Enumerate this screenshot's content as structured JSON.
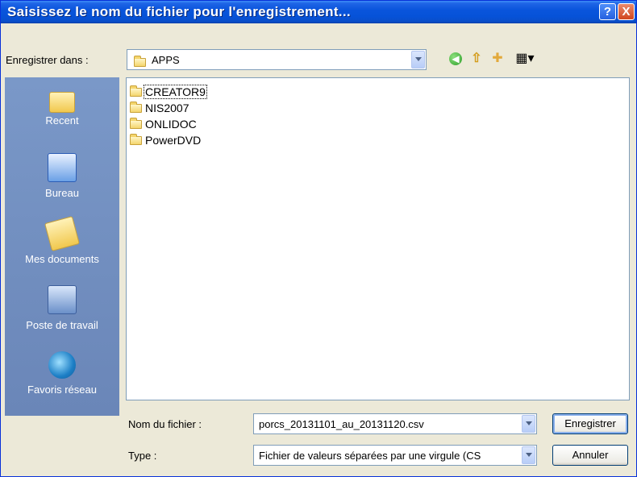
{
  "window": {
    "title": "Saisissez le nom du fichier pour l'enregistrement...",
    "help_glyph": "?",
    "close_glyph": "X"
  },
  "savein": {
    "label": "Enregistrer dans :",
    "value": "APPS"
  },
  "toolbar": {
    "icons": [
      "back-icon",
      "up-folder-icon",
      "new-folder-icon",
      "views-menu-icon"
    ],
    "back_glyph": "◀",
    "up_glyph": "⇧",
    "newfolder_glyph": "✚",
    "views_glyph": "▦▾"
  },
  "places": [
    {
      "label": "Recent",
      "icon": "recent-folder-icon"
    },
    {
      "label": "Bureau",
      "icon": "desktop-icon"
    },
    {
      "label": "Mes documents",
      "icon": "my-documents-icon"
    },
    {
      "label": "Poste de travail",
      "icon": "my-computer-icon"
    },
    {
      "label": "Favoris réseau",
      "icon": "network-places-icon"
    }
  ],
  "files": [
    {
      "name": "CREATOR9",
      "focused": true
    },
    {
      "name": "NIS2007",
      "focused": false
    },
    {
      "name": "ONLIDOC",
      "focused": false
    },
    {
      "name": "PowerDVD",
      "focused": false
    }
  ],
  "filename": {
    "label": "Nom du fichier :",
    "value": "porcs_20131101_au_20131120.csv"
  },
  "filetype": {
    "label": "Type :",
    "value": "Fichier de valeurs séparées par une virgule (CS"
  },
  "buttons": {
    "save": "Enregistrer",
    "cancel": "Annuler"
  },
  "colors": {
    "titlebar": "#0a55dc",
    "places_bar": "#7090b0",
    "dialog_bg": "#ece9d8"
  }
}
